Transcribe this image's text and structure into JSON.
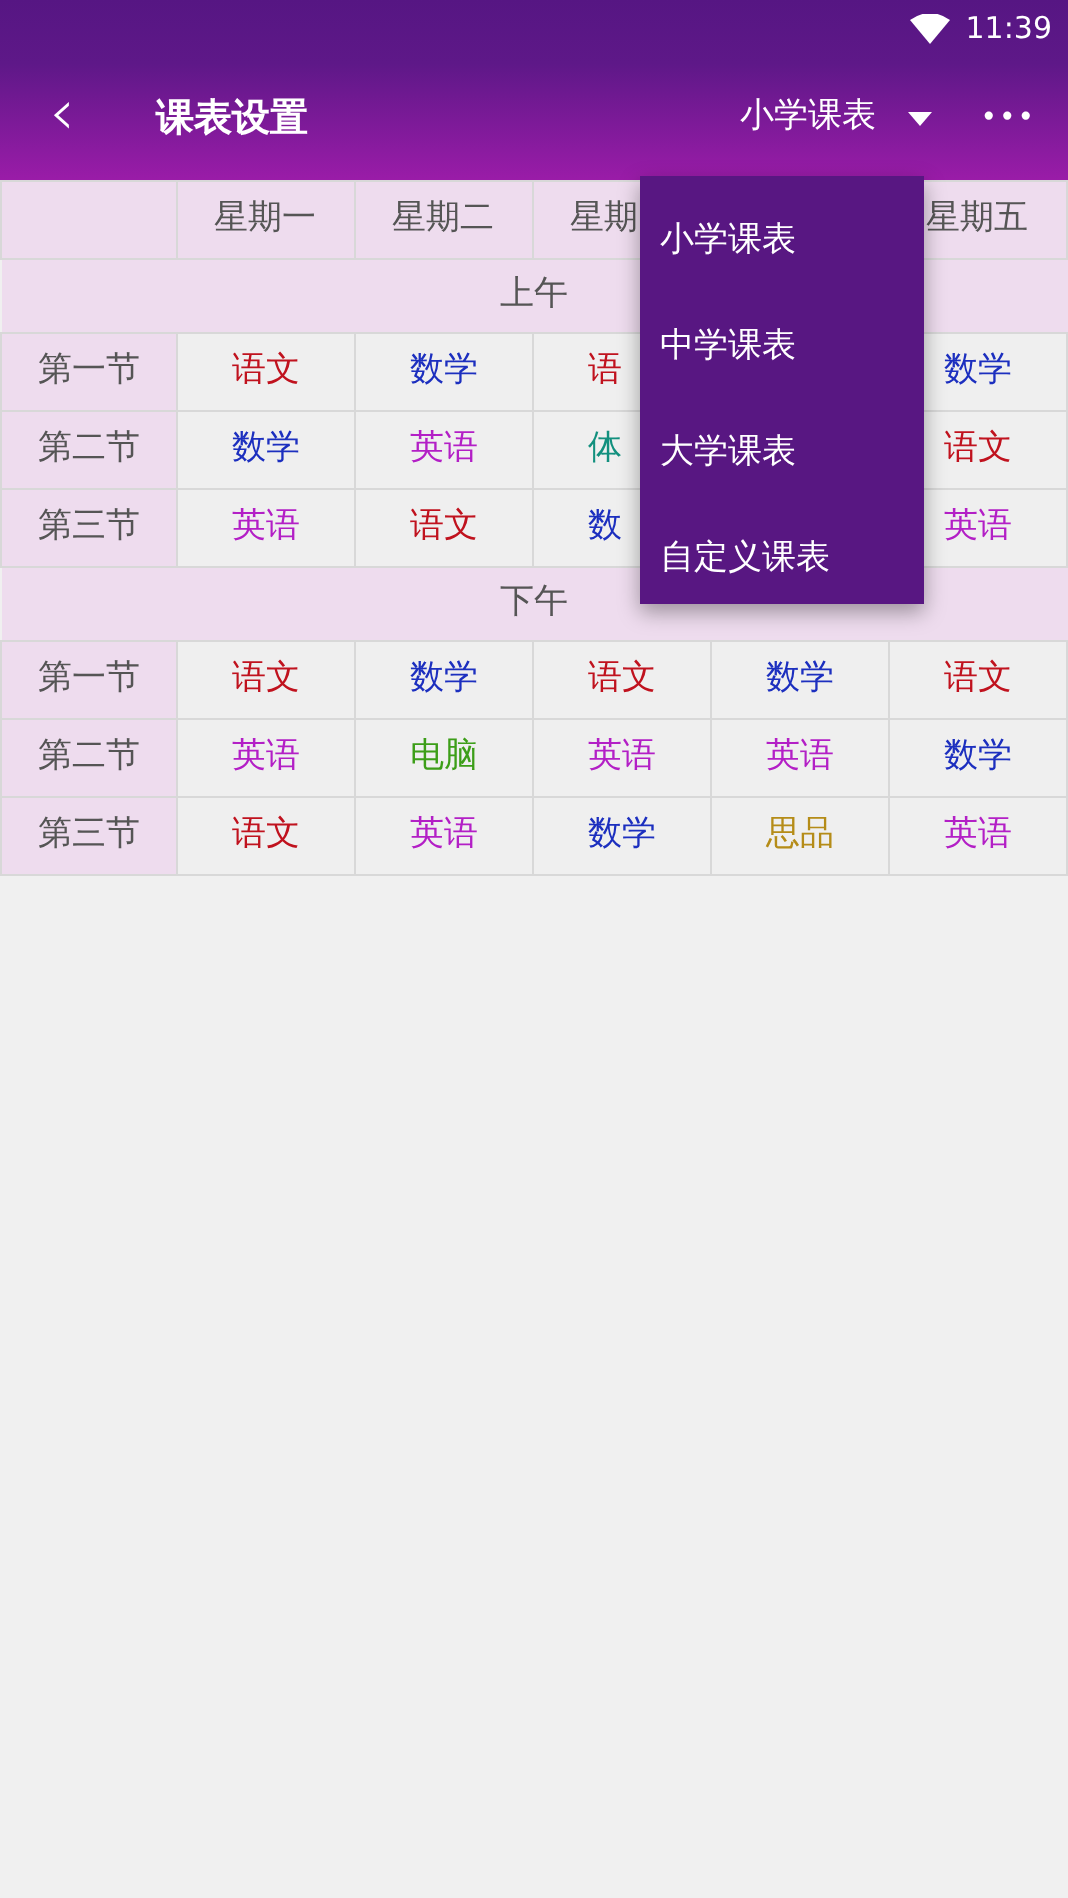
{
  "status_bar": {
    "time": "11:39"
  },
  "toolbar": {
    "back": "‹",
    "title": "课表设置",
    "selector": "小学课表",
    "more": "•••"
  },
  "timetable": {
    "headers_left": [
      "星期一",
      "星期二",
      "星期"
    ],
    "headers_right": [
      "星期五"
    ],
    "sections": [
      {
        "label": "上午",
        "rows": [
          {
            "label": "第一节",
            "cells": [
              {
                "text": "语文",
                "color": "#c0121e"
              },
              {
                "text": "数学",
                "color": "#1c2fbf"
              },
              {
                "text": "语",
                "color": "#c0121e"
              },
              null,
              {
                "text": "数学",
                "color": "#1c2fbf"
              }
            ]
          },
          {
            "label": "第二节",
            "cells": [
              {
                "text": "数学",
                "color": "#1c2fbf"
              },
              {
                "text": "英语",
                "color": "#b31fc6"
              },
              {
                "text": "体",
                "color": "#12907e"
              },
              null,
              {
                "text": "语文",
                "color": "#c0121e"
              }
            ]
          },
          {
            "label": "第三节",
            "cells": [
              {
                "text": "英语",
                "color": "#b31fc6"
              },
              {
                "text": "语文",
                "color": "#c0121e"
              },
              {
                "text": "数",
                "color": "#1c2fbf"
              },
              null,
              {
                "text": "英语",
                "color": "#b31fc6"
              }
            ]
          }
        ]
      },
      {
        "label": "下午",
        "rows": [
          {
            "label": "第一节",
            "cells": [
              {
                "text": "语文",
                "color": "#c0121e"
              },
              {
                "text": "数学",
                "color": "#1c2fbf"
              },
              {
                "text": "语文",
                "color": "#c0121e"
              },
              {
                "text": "数学",
                "color": "#1c2fbf"
              },
              {
                "text": "语文",
                "color": "#c0121e"
              }
            ]
          },
          {
            "label": "第二节",
            "cells": [
              {
                "text": "英语",
                "color": "#b31fc6"
              },
              {
                "text": "电脑",
                "color": "#3c9e18"
              },
              {
                "text": "英语",
                "color": "#b31fc6"
              },
              {
                "text": "英语",
                "color": "#b31fc6"
              },
              {
                "text": "数学",
                "color": "#1c2fbf"
              }
            ]
          },
          {
            "label": "第三节",
            "cells": [
              {
                "text": "语文",
                "color": "#c0121e"
              },
              {
                "text": "英语",
                "color": "#b31fc6"
              },
              {
                "text": "数学",
                "color": "#1c2fbf"
              },
              {
                "text": "思品",
                "color": "#b58c18"
              },
              {
                "text": "英语",
                "color": "#b31fc6"
              }
            ]
          }
        ]
      }
    ]
  },
  "menu": {
    "items": [
      "小学课表",
      "中学课表",
      "大学课表",
      "自定义课表"
    ]
  }
}
